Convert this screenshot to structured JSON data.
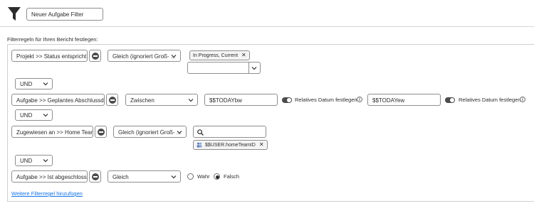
{
  "header": {
    "filter_name": "Neuer Aufgabe Filter"
  },
  "section_title": "Filterregeln für Ihren Bericht festlegen:",
  "rules": [
    {
      "field": "Projekt >> Status entspricht",
      "operator": "Gleich (ignoriert Groß- ...",
      "tags": [
        "In Progress, Current"
      ],
      "empty_select": ""
    },
    {
      "field": "Aufgabe >> Geplantes Abschlussdatum",
      "operator": "Zwischen",
      "value_from": "$$TODAYbw",
      "value_to": "$$TODAYew",
      "relative_label_1": "Relatives Datum festlegen",
      "relative_label_2": "Relatives Datum festlegen"
    },
    {
      "field": "Zugewiesen an >> Home Team ID",
      "operator": "Gleich (ignoriert Groß- ...",
      "search_value": "",
      "tags": [
        "$$USER.homeTeamID"
      ]
    },
    {
      "field": "Aufgabe >> Ist abgeschlossen",
      "operator": "Gleich",
      "radio_true": "Wahr",
      "radio_false": "Falsch"
    }
  ],
  "connectors": [
    "UND",
    "UND",
    "UND"
  ],
  "add_rule_link": "Weitere Filterregel hinzufügen",
  "colors": {
    "link": "#1473e6",
    "border": "#8e8e8e",
    "dark": "#4b4b4b"
  }
}
